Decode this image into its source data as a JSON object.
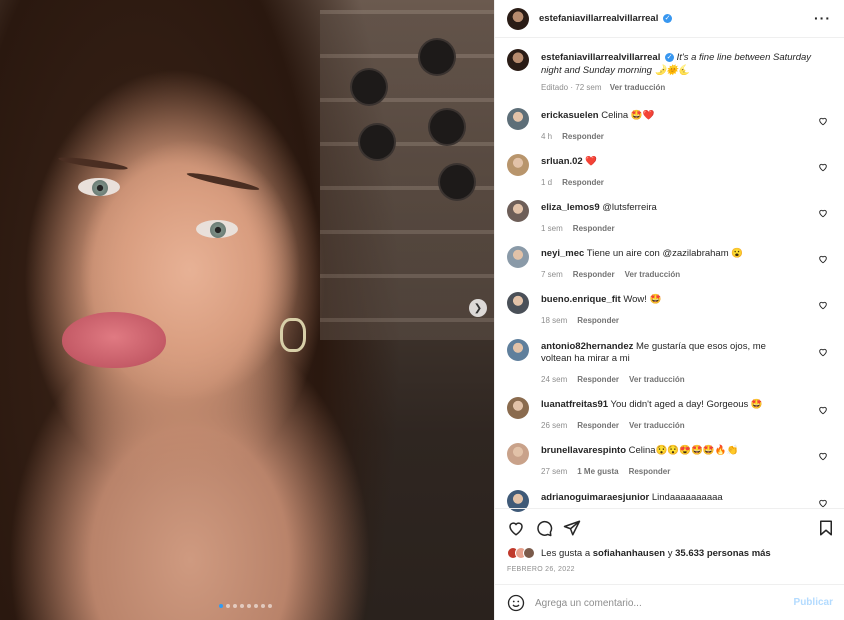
{
  "post": {
    "author": "estefaniavillarrealvillarreal",
    "caption_user": "estefaniavillarrealvillarreal",
    "caption_text": "It's a fine line between Saturday night and Sunday morning 🌛🌞🌜",
    "caption_meta_edited": "Editado · 72 sem",
    "caption_translate": "Ver traducción",
    "photo_page": 1,
    "photo_page_count": 8
  },
  "comments": [
    {
      "user": "erickasuelen",
      "text": "Celina 🤩❤️",
      "meta": "4 h",
      "reply": "Responder",
      "translate": ""
    },
    {
      "user": "srluan.02",
      "text": "❤️",
      "meta": "1 d",
      "reply": "Responder",
      "translate": ""
    },
    {
      "user": "eliza_lemos9",
      "text": "@lutsferreira",
      "meta": "1 sem",
      "reply": "Responder",
      "translate": ""
    },
    {
      "user": "neyi_mec",
      "text": "Tiene un aire con @zazilabraham 😮",
      "meta": "7 sem",
      "reply": "Responder",
      "translate": "Ver traducción"
    },
    {
      "user": "bueno.enrique_fit",
      "text": "Wow! 🤩",
      "meta": "18 sem",
      "reply": "Responder",
      "translate": ""
    },
    {
      "user": "antonio82hernandez",
      "text": "Me gustaría que esos ojos, me voltean ha mirar a mi",
      "meta": "24 sem",
      "reply": "Responder",
      "translate": "Ver traducción"
    },
    {
      "user": "luanatfreitas91",
      "text": "You didn't aged a day! Gorgeous 🤩",
      "meta": "26 sem",
      "reply": "Responder",
      "translate": "Ver traducción"
    },
    {
      "user": "brunellavarespinto",
      "text": "Celina😯😯😍🤩🤩🔥👏",
      "meta": "27 sem",
      "likes": "1 Me gusta",
      "reply": "Responder",
      "translate": ""
    },
    {
      "user": "adrianoguimaraesjunior",
      "text": "Lindaaaaaaaaaa",
      "meta": "",
      "reply": "",
      "translate": ""
    }
  ],
  "likes": {
    "prefix": "Les gusta a",
    "user": "sofiahanhausen",
    "middle": "y",
    "count": "35.633 personas más"
  },
  "date": "FEBRERO 26, 2022",
  "compose": {
    "placeholder": "Agrega un comentario...",
    "publish": "Publicar"
  },
  "icons": [
    "more-icon",
    "heart-icon",
    "comment-icon",
    "share-icon",
    "bookmark-icon",
    "emoji-icon",
    "chevron-right-icon",
    "verified-icon"
  ],
  "colors": {
    "accent": "#0095f6",
    "verified": "#3897f0",
    "like_red": "#ed4956",
    "muted": "#8e8e8e"
  }
}
